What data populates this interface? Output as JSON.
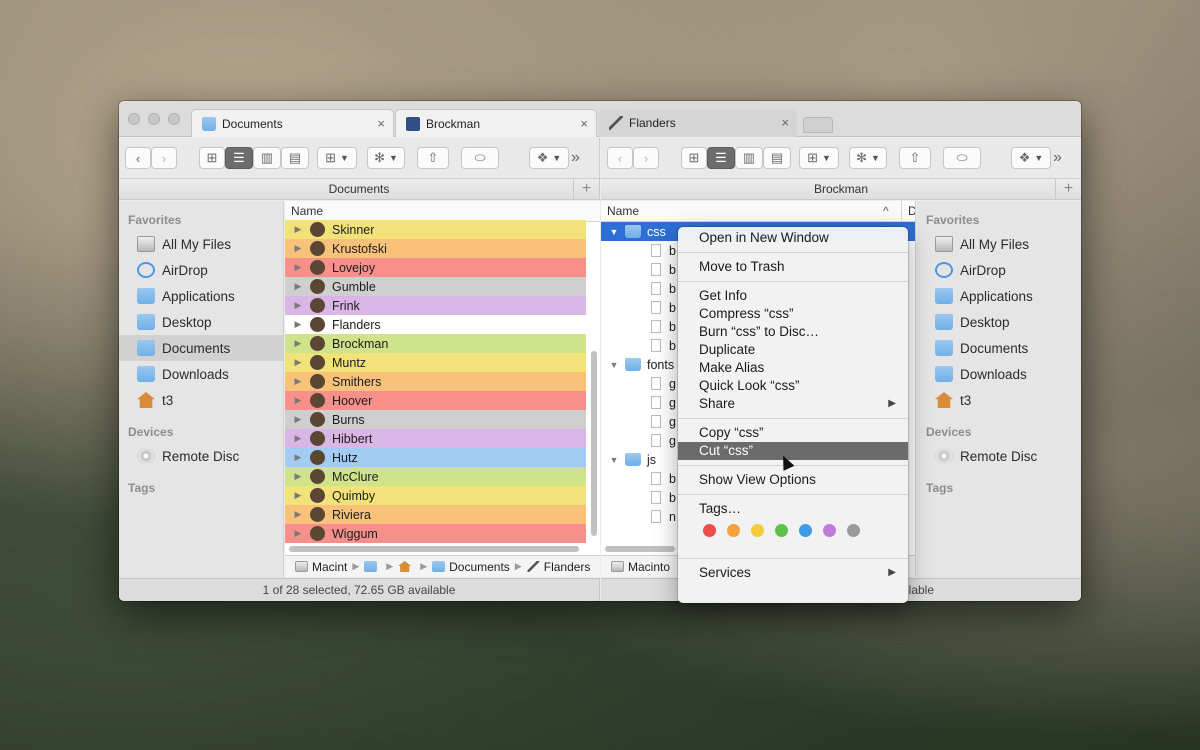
{
  "tabs": [
    {
      "label": "Documents",
      "close": "×"
    },
    {
      "label": "Brockman",
      "close": "×"
    },
    {
      "label": "Flanders",
      "close": "×"
    }
  ],
  "toolbar": {
    "back": "‹",
    "forward": "›",
    "more": "»",
    "view_icons": "⊞",
    "view_list": "☰",
    "view_columns": "▥",
    "view_flow": "▤",
    "arrange": "⊞",
    "action": "✻",
    "share": "⇧",
    "tag": "⬭",
    "dropbox": "❖"
  },
  "left_pane": {
    "path_title": "Documents",
    "plus": "+",
    "column_name": "Name",
    "status": "1 of 28 selected, 72.65 GB available",
    "rows": [
      {
        "name": "Skinner",
        "color": "#f2e27a"
      },
      {
        "name": "Krustofski",
        "color": "#f8c27a"
      },
      {
        "name": "Lovejoy",
        "color": "#f7908a"
      },
      {
        "name": "Gumble",
        "color": "#cfcfcf"
      },
      {
        "name": "Frink",
        "color": "#d9b6e6"
      },
      {
        "name": "Flanders",
        "color": "#ffffff"
      },
      {
        "name": "Brockman",
        "color": "#cfe38a"
      },
      {
        "name": "Muntz",
        "color": "#f2e27a"
      },
      {
        "name": "Smithers",
        "color": "#f8c27a"
      },
      {
        "name": "Hoover",
        "color": "#f7908a"
      },
      {
        "name": "Burns",
        "color": "#cfcfcf"
      },
      {
        "name": "Hibbert",
        "color": "#d9b6e6"
      },
      {
        "name": "Hutz",
        "color": "#a3ccf5"
      },
      {
        "name": "McClure",
        "color": "#cfe38a"
      },
      {
        "name": "Quimby",
        "color": "#f2e27a"
      },
      {
        "name": "Riviera",
        "color": "#f8c27a"
      },
      {
        "name": "Wiggum",
        "color": "#f7908a"
      }
    ],
    "breadcrumb": [
      "Macint",
      "Documents",
      "Flanders"
    ]
  },
  "sidebar_left": {
    "favorites_heading": "Favorites",
    "favorites": [
      "All My Files",
      "AirDrop",
      "Applications",
      "Desktop",
      "Documents",
      "Downloads",
      "t3"
    ],
    "devices_heading": "Devices",
    "devices": [
      "Remote Disc"
    ],
    "tags_heading": "Tags"
  },
  "right_pane": {
    "path_title": "Brockman",
    "plus": "+",
    "column_name": "Name",
    "column_sort": "^",
    "column_d": "D",
    "status_suffix": "ilable",
    "breadcrumb_start": "Macinto",
    "rows": [
      {
        "name": "css",
        "indent": 0,
        "disclosure": "▼",
        "folder": true,
        "selected": true
      },
      {
        "name": "b",
        "indent": 1
      },
      {
        "name": "b",
        "indent": 1
      },
      {
        "name": "b",
        "indent": 1
      },
      {
        "name": "b",
        "indent": 1
      },
      {
        "name": "b",
        "indent": 1
      },
      {
        "name": "b",
        "indent": 1
      },
      {
        "name": "fonts",
        "indent": 0,
        "disclosure": "▼",
        "folder": true
      },
      {
        "name": "g",
        "indent": 1
      },
      {
        "name": "g",
        "indent": 1
      },
      {
        "name": "g",
        "indent": 1
      },
      {
        "name": "g",
        "indent": 1
      },
      {
        "name": "js",
        "indent": 0,
        "disclosure": "▼",
        "folder": true
      },
      {
        "name": "b",
        "indent": 1
      },
      {
        "name": "b",
        "indent": 1
      },
      {
        "name": "n",
        "indent": 1
      }
    ]
  },
  "sidebar_right": {
    "favorites_heading": "Favorites",
    "favorites": [
      "All My Files",
      "AirDrop",
      "Applications",
      "Desktop",
      "Documents",
      "Downloads",
      "t3"
    ],
    "devices_heading": "Devices",
    "devices": [
      "Remote Disc"
    ],
    "tags_heading": "Tags"
  },
  "context_menu": {
    "open_new_window": "Open in New Window",
    "move_to_trash": "Move to Trash",
    "get_info": "Get Info",
    "compress": "Compress “css”",
    "burn": "Burn “css” to Disc…",
    "duplicate": "Duplicate",
    "make_alias": "Make Alias",
    "quick_look": "Quick Look “css”",
    "share": "Share",
    "copy": "Copy “css”",
    "cut": "Cut “css”",
    "show_view_options": "Show View Options",
    "tags": "Tags…",
    "services": "Services",
    "submenu_arrow": "▶",
    "tag_colors": [
      "#ec4d49",
      "#f4a23b",
      "#f4cb3a",
      "#5dc24c",
      "#3d9ce8",
      "#c27ad9",
      "#9a9a9a"
    ]
  }
}
